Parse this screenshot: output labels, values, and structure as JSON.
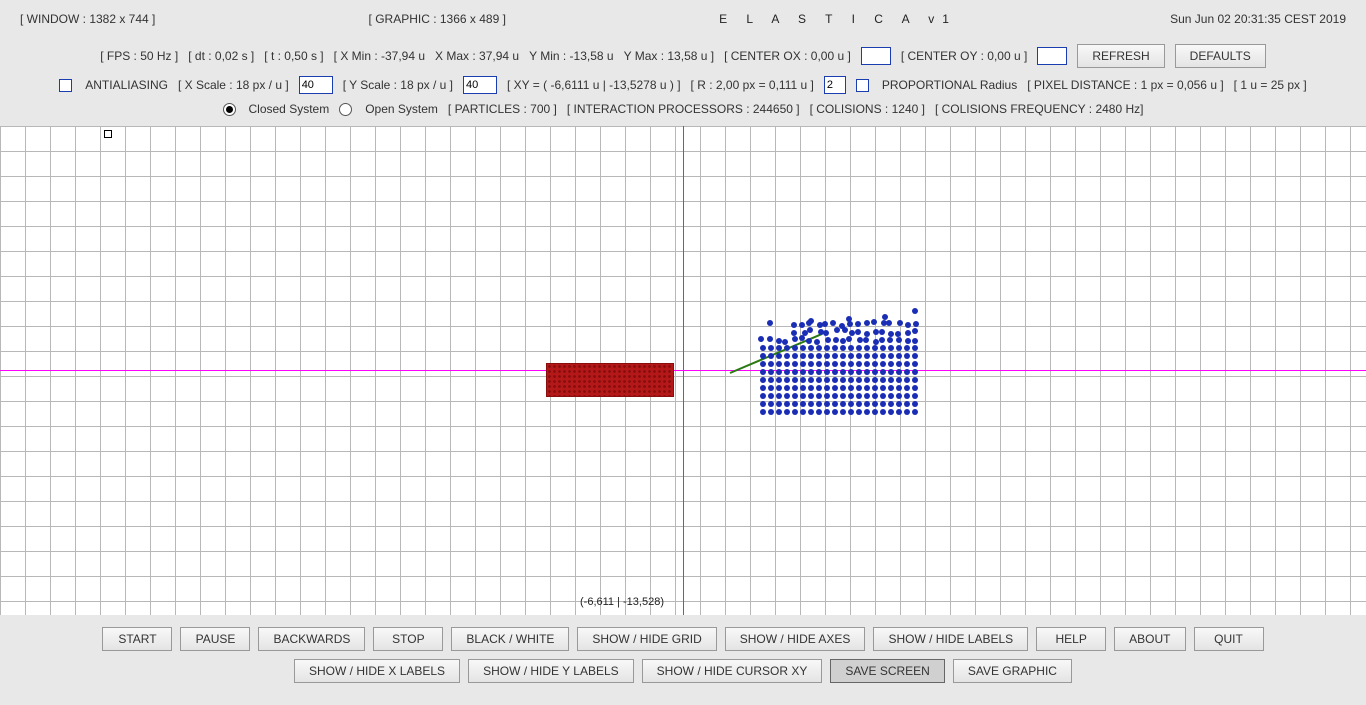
{
  "header": {
    "window": "[  WINDOW : 1382 x 744  ]",
    "graphic": "[  GRAPHIC : 1366 x 489  ]",
    "title": "E  L  A  S  T  I  C  A     v1",
    "datetime": "Sun Jun 02 20:31:35 CEST 2019"
  },
  "row2": {
    "fps": "[ FPS : 50 Hz ]",
    "dt": "[  dt : 0,02 s  ]",
    "t": "[  t : 0,50 s  ]",
    "xmin": "[ X Min : -37,94 u",
    "xmax": "X Max :  37,94 u",
    "ymin": "Y Min :  -13,58 u",
    "ymax": "Y Max :  13,58 u  ]",
    "centerox": "[  CENTER OX  : 0,00 u  ]",
    "centeroy": "[  CENTER OY  : 0,00 u  ]",
    "refresh": "REFRESH",
    "defaults": "DEFAULTS"
  },
  "row3": {
    "antialias": "ANTIALIASING",
    "xscale": "[ X Scale : 18 px / u ]",
    "xscale_val": "40",
    "yscale": "[ Y Scale : 18 px / u ]",
    "yscale_val": "40",
    "xy": "[ XY = ( -6,6111 u | -13,5278 u ) ]",
    "r": "[ R : 2,00 px = 0,111 u ]",
    "r_val": "2",
    "propr": "PROPORTIONAL Radius",
    "pixd": "[ PIXEL DISTANCE : 1 px = 0,056 u ]",
    "pixu": "[ 1 u = 25 px ]"
  },
  "row4": {
    "closed": "Closed System",
    "open": "Open System",
    "particles": "[ PARTICLES : 700 ]",
    "iproc": "[ INTERACTION PROCESSORS : 244650 ]",
    "colis": "[ COLISIONS : 1240 ]",
    "colisf": "[ COLISIONS FREQUENCY : 2480 Hz]"
  },
  "canvas": {
    "cursor": "(-6,611 | -13,528)"
  },
  "buttons1": {
    "start": "START",
    "pause": "PAUSE",
    "back": "BACKWARDS",
    "stop": "STOP",
    "bw": "BLACK / WHITE",
    "grid": "SHOW / HIDE GRID",
    "axes": "SHOW / HIDE AXES",
    "labels": "SHOW / HIDE LABELS",
    "help": "HELP",
    "about": "ABOUT",
    "quit": "QUIT"
  },
  "buttons2": {
    "xlabels": "SHOW / HIDE X LABELS",
    "ylabels": "SHOW / HIDE Y LABELS",
    "cursor": "SHOW / HIDE CURSOR XY",
    "savescr": "SAVE SCREEN",
    "savegr": "SAVE GRAPHIC"
  }
}
